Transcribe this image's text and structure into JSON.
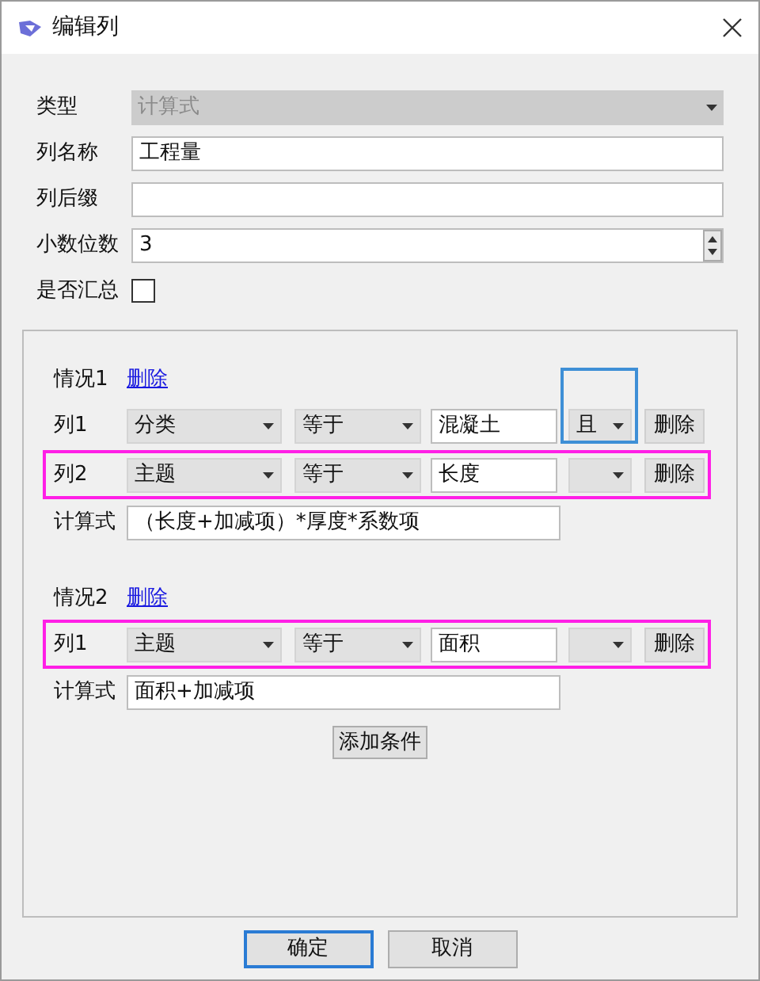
{
  "window": {
    "title": "编辑列"
  },
  "form": {
    "type": {
      "label": "类型",
      "value": "计算式",
      "disabled": true
    },
    "name": {
      "label": "列名称",
      "value": "工程量"
    },
    "suffix": {
      "label": "列后缀"
    },
    "decimals": {
      "label": "小数位数",
      "value": "3"
    },
    "summary": {
      "label": "是否汇总",
      "checked": false
    }
  },
  "cases": [
    {
      "title": "情况1",
      "delete_link": "删除",
      "conditions": [
        {
          "column": "列1",
          "field": "分类",
          "operator": "等于",
          "value": "混凝土",
          "connector": "且",
          "connector_highlighted": true,
          "highlighted": false,
          "delete_button": "删除"
        },
        {
          "column": "列2",
          "field": "主题",
          "operator": "等于",
          "value": "长度",
          "connector_highlighted": false,
          "highlighted": true,
          "delete_button": "删除"
        }
      ],
      "formula_label": "计算式",
      "formula": "（长度+加减项）*厚度*系数项"
    },
    {
      "title": "情况2",
      "delete_link": "删除",
      "conditions": [
        {
          "column": "列1",
          "field": "主题",
          "operator": "等于",
          "value": "面积",
          "connector_highlighted": false,
          "highlighted": true,
          "delete_button": "删除"
        }
      ],
      "formula_label": "计算式",
      "formula": "面积+加减项"
    }
  ],
  "add_button": "添加条件",
  "buttons": [
    {
      "label": "确定",
      "default": true
    },
    {
      "label": "取消",
      "default": false
    }
  ]
}
